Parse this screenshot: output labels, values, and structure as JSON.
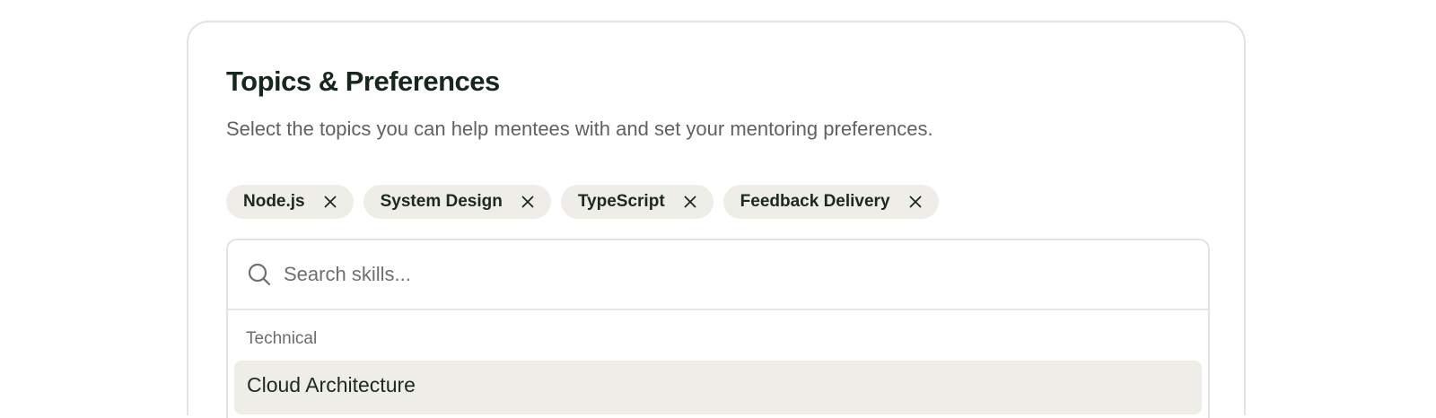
{
  "section": {
    "title": "Topics & Preferences",
    "subtitle": "Select the topics you can help mentees with and set your mentoring preferences."
  },
  "selected_topics": [
    {
      "label": "Node.js",
      "remove_icon": "close-icon"
    },
    {
      "label": "System Design",
      "remove_icon": "close-icon"
    },
    {
      "label": "TypeScript",
      "remove_icon": "close-icon"
    },
    {
      "label": "Feedback Delivery",
      "remove_icon": "close-icon"
    }
  ],
  "search": {
    "placeholder": "Search skills...",
    "value": "",
    "icon": "search-icon"
  },
  "dropdown": {
    "groups": [
      {
        "label": "Technical",
        "options": [
          {
            "label": "Cloud Architecture",
            "highlighted": true
          }
        ]
      }
    ]
  },
  "colors": {
    "chip_background": "#efede7",
    "highlight_background": "#efede7",
    "title_text": "#16271d",
    "muted_text": "#5e635c",
    "border": "#e3e3e0"
  }
}
